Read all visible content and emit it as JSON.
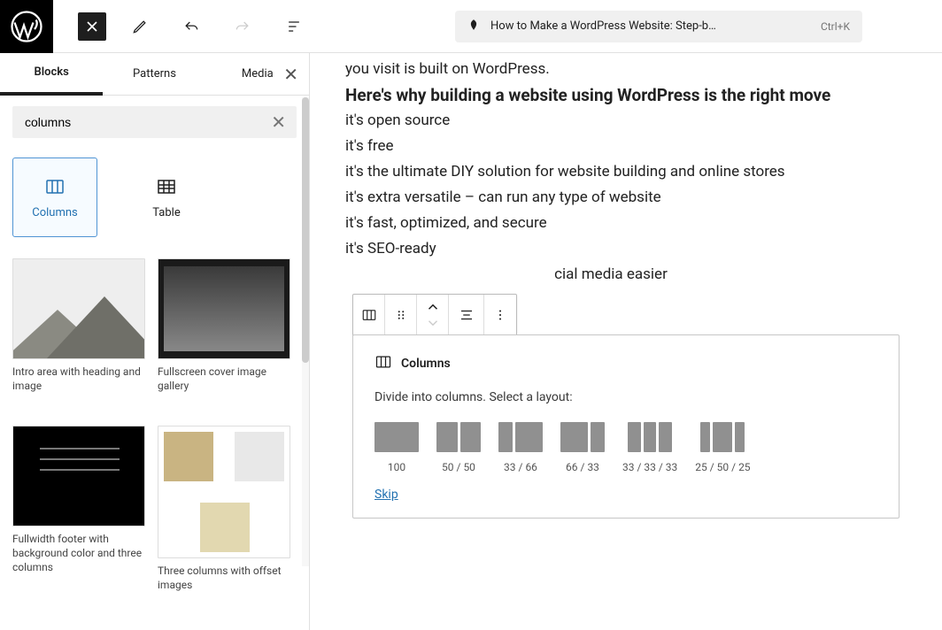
{
  "header": {
    "title": "How to Make a WordPress Website: Step-b…",
    "shortcut": "Ctrl+K"
  },
  "tabs": [
    "Blocks",
    "Patterns",
    "Media"
  ],
  "search": {
    "value": "columns"
  },
  "blocks": [
    {
      "id": "columns",
      "label": "Columns",
      "selected": true
    },
    {
      "id": "table",
      "label": "Table",
      "selected": false
    }
  ],
  "patterns": [
    {
      "id": "intro",
      "caption": "Intro area with heading and image"
    },
    {
      "id": "cover",
      "caption": "Fullscreen cover image gallery"
    },
    {
      "id": "footer",
      "caption": "Fullwidth footer with background color and three columns"
    },
    {
      "id": "threec",
      "caption": "Three columns with offset images"
    }
  ],
  "content": {
    "p0": "you visit is built on WordPress.",
    "h": "Here's why building a website using WordPress is the right move",
    "li": [
      "it's open source",
      "it's free",
      "it's the ultimate DIY solution for website building and online stores",
      "it's extra versatile – can run any type of website",
      "it's fast, optimized, and secure",
      "it's SEO-ready",
      "                                                        cial media easier"
    ]
  },
  "colpanel": {
    "title": "Columns",
    "desc": "Divide into columns. Select a layout:",
    "skip": "Skip",
    "opts": [
      {
        "label": "100",
        "cols": [
          "w100"
        ]
      },
      {
        "label": "50 / 50",
        "cols": [
          "w50",
          "w50"
        ]
      },
      {
        "label": "33 / 66",
        "cols": [
          "w33",
          "w66"
        ]
      },
      {
        "label": "66 / 33",
        "cols": [
          "w66",
          "w33"
        ]
      },
      {
        "label": "33 / 33 / 33",
        "cols": [
          "w33",
          "w33",
          "w33"
        ]
      },
      {
        "label": "25 / 50 / 25",
        "cols": [
          "w25",
          "w50",
          "w25"
        ]
      }
    ]
  }
}
